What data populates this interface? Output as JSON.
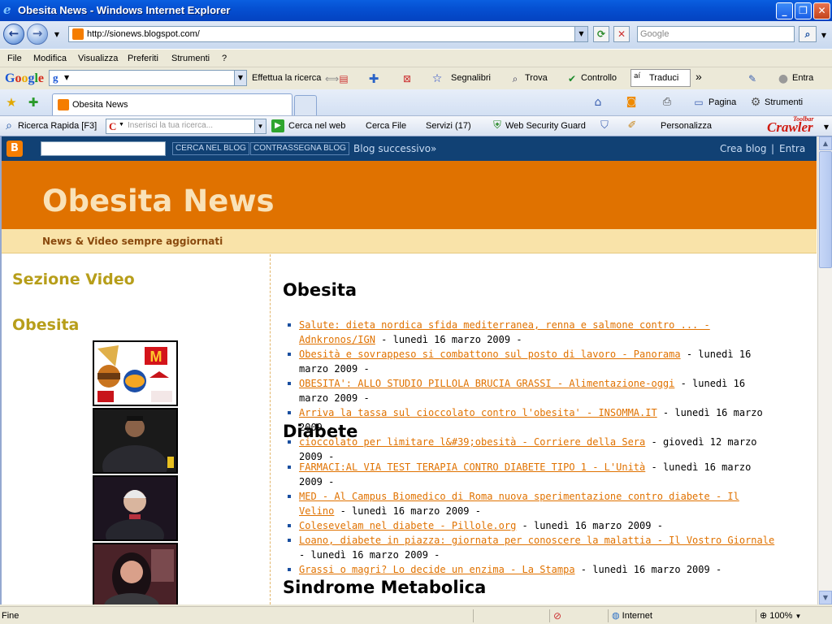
{
  "window": {
    "title": "Obesita News - Windows Internet Explorer"
  },
  "address": {
    "url": "http://sionews.blogspot.com/",
    "search_placeholder": "Google"
  },
  "menu": [
    "File",
    "Modifica",
    "Visualizza",
    "Preferiti",
    "Strumenti",
    "?"
  ],
  "google_toolbar": {
    "logo": [
      "G",
      "o",
      "o",
      "g",
      "l",
      "e"
    ],
    "search_glyph": "g",
    "search_label": "Effettua la ricerca",
    "bookmarks_label": "Segnalibri",
    "find_label": "Trova",
    "spell_label": "Controllo",
    "translate_label": "Traduci",
    "signin_label": "Entra",
    "chevron": "»"
  },
  "tabs": {
    "active": "Obesita News",
    "page_label": "Pagina",
    "tools_label": "Strumenti"
  },
  "crawler_bar": {
    "quick_search": "Ricerca Rapida [F3]",
    "placeholder": "Inserisci la tua ricerca...",
    "web_search": "Cerca nel web",
    "file_search": "Cerca File",
    "services": "Servizi (17)",
    "security": "Web Security Guard",
    "customize": "Personalizza",
    "logo": "Crawler",
    "logo_sub": "Toolbar"
  },
  "blogger_nav": {
    "search_button": "CERCA NEL BLOG",
    "flag_button": "CONTRASSEGNA BLOG",
    "next_blog": "Blog successivo»",
    "create_blog": "Crea blog",
    "separator": "|",
    "signin": "Entra"
  },
  "blog": {
    "title": "Obesita News",
    "description": "News & Video sempre aggiornati"
  },
  "sidebar": {
    "video_heading": "Sezione Video",
    "obesita_heading": "Obesita"
  },
  "sections": [
    {
      "heading": "Obesita",
      "items": [
        {
          "link": "Salute: dieta nordica sfida mediterranea, renna e salmone contro ... - Adnkronos/IGN",
          "date": " - lunedì 16 marzo 2009 -"
        },
        {
          "link": "Obesità e sovrappeso si combattono sul posto di lavoro - Panorama",
          "date": " - lunedì 16 marzo 2009 -"
        },
        {
          "link": "OBESITA': ALLO STUDIO PILLOLA BRUCIA GRASSI - Alimentazione-oggi",
          "date": " - lunedì 16 marzo 2009 -"
        },
        {
          "link": "Arriva la tassa sul cioccolato contro l'obesita' - INSOMMA.IT",
          "date": " - lunedì 16 marzo 2009 -"
        },
        {
          "link": "cioccolato per limitare l&#39;obesità - Corriere della Sera",
          "date": " - giovedì 12 marzo 2009 -"
        }
      ]
    },
    {
      "heading": "Diabete",
      "items": [
        {
          "link": "FARMACI:AL VIA TEST TERAPIA CONTRO DIABETE TIPO 1 - L'Unità",
          "date": " - lunedì 16 marzo 2009 -"
        },
        {
          "link": "MED - Al Campus Biomedico di Roma nuova sperimentazione contro diabete - Il Velino",
          "date": " - lunedì 16 marzo 2009 -"
        },
        {
          "link": "Colesevelam nel diabete - Pillole.org",
          "date": " - lunedì 16 marzo 2009 -"
        },
        {
          "link": "Loano, diabete in piazza: giornata per conoscere la malattia - Il Vostro Giornale",
          "date": " - lunedì 16 marzo 2009 -"
        },
        {
          "link": "Grassi o magri? Lo decide un enzima - La Stampa",
          "date": " - lunedì 16 marzo 2009 -"
        }
      ]
    },
    {
      "heading": "Sindrome Metabolica",
      "items": []
    }
  ],
  "status": {
    "text": "Fine",
    "zone": "Internet",
    "zoom": "100%"
  },
  "colors": {
    "blog_header": "#e07200",
    "blog_desc_bg": "#f9e3a9",
    "link": "#e07200",
    "sidebar_heading": "#b79e1a",
    "navbar": "#114174"
  }
}
